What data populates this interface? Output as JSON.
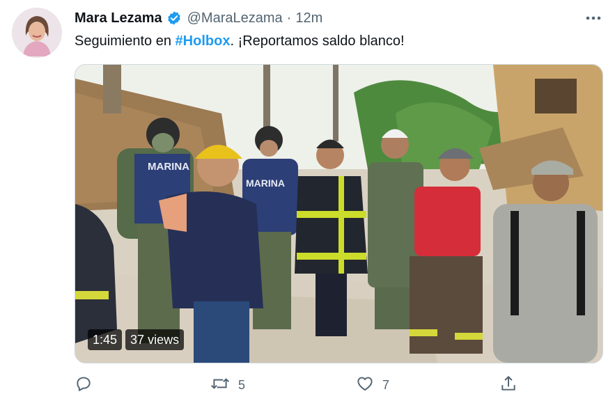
{
  "tweet": {
    "author_name": "Mara Lezama",
    "handle": "@MaraLezama",
    "separator": "·",
    "time": "12m",
    "text_before": "Seguimiento en ",
    "hashtag": "#Holbox",
    "text_after": ". ¡Reportamos saldo blanco!"
  },
  "video": {
    "duration": "1:45",
    "views": "37 views",
    "helmet_text": "MARINA"
  },
  "actions": {
    "reply_count": "",
    "retweet_count": "5",
    "like_count": "7"
  },
  "colors": {
    "accent": "#1d9bf0",
    "text": "#0f1419",
    "muted": "#536471"
  },
  "icons": [
    "verified-badge-icon",
    "more-icon",
    "reply-icon",
    "retweet-icon",
    "like-icon",
    "share-icon"
  ]
}
